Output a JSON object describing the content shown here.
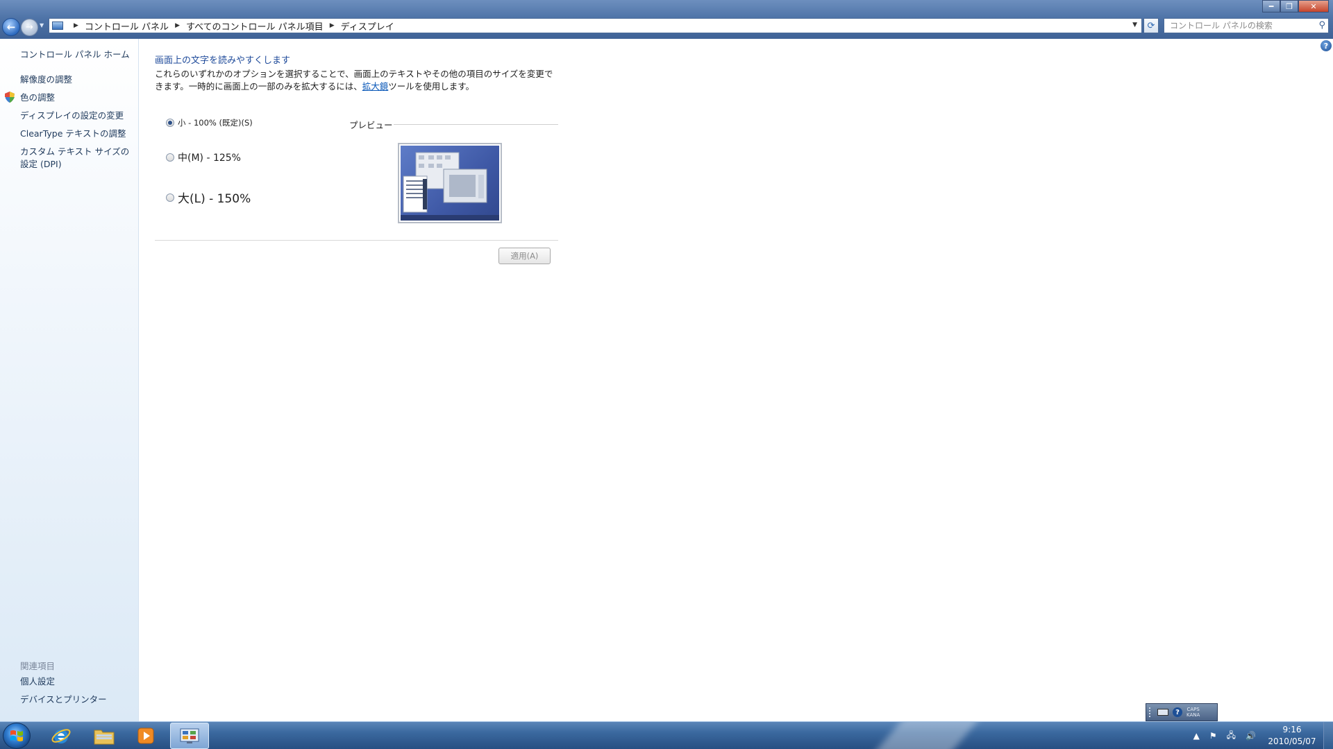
{
  "window": {
    "minimize_label": "━",
    "maximize_label": "❐",
    "close_label": "✕"
  },
  "nav": {
    "back_label": "←",
    "forward_label": "→"
  },
  "address": {
    "breadcrumbs": [
      "コントロール パネル",
      "すべてのコントロール パネル項目",
      "ディスプレイ"
    ]
  },
  "search": {
    "placeholder": "コントロール パネルの検索"
  },
  "sidebar": {
    "home": "コントロール パネル ホーム",
    "items": [
      {
        "label": "解像度の調整"
      },
      {
        "label": "色の調整"
      },
      {
        "label": "ディスプレイの設定の変更"
      },
      {
        "label": "ClearType テキストの調整"
      },
      {
        "label": "カスタム テキスト サイズの設定 (DPI)"
      }
    ],
    "related_heading": "関連項目",
    "related_items": [
      {
        "label": "個人設定"
      },
      {
        "label": "デバイスとプリンター"
      }
    ]
  },
  "main": {
    "title": "画面上の文字を読みやすくします",
    "description_part1": "これらのいずれかのオプションを選択することで、画面上のテキストやその他の項目のサイズを変更できます。一時的に画面上の一部のみを拡大するには、",
    "description_link": "拡大鏡",
    "description_part2": "ツールを使用します。",
    "options": [
      {
        "label": "小 - 100% (既定)(S)",
        "selected": true
      },
      {
        "label": "中(M) - 125%",
        "selected": false
      },
      {
        "label": "大(L) - 150%",
        "selected": false
      }
    ],
    "preview_label": "プレビュー",
    "apply_button": "適用(A)"
  },
  "langbar": {
    "help_label": "?",
    "caps_label": "CAPS",
    "kana_label": "KANA"
  },
  "taskbar": {
    "apps": [
      "start-orb",
      "internet-explorer",
      "windows-explorer",
      "windows-media-player",
      "control-panel"
    ],
    "active_app": "control-panel"
  },
  "tray": {
    "time": "9:16",
    "date": "2010/05/07"
  },
  "colors": {
    "link": "#1e395b",
    "title": "#1e4a9a",
    "taskbar": "#3a689e"
  }
}
